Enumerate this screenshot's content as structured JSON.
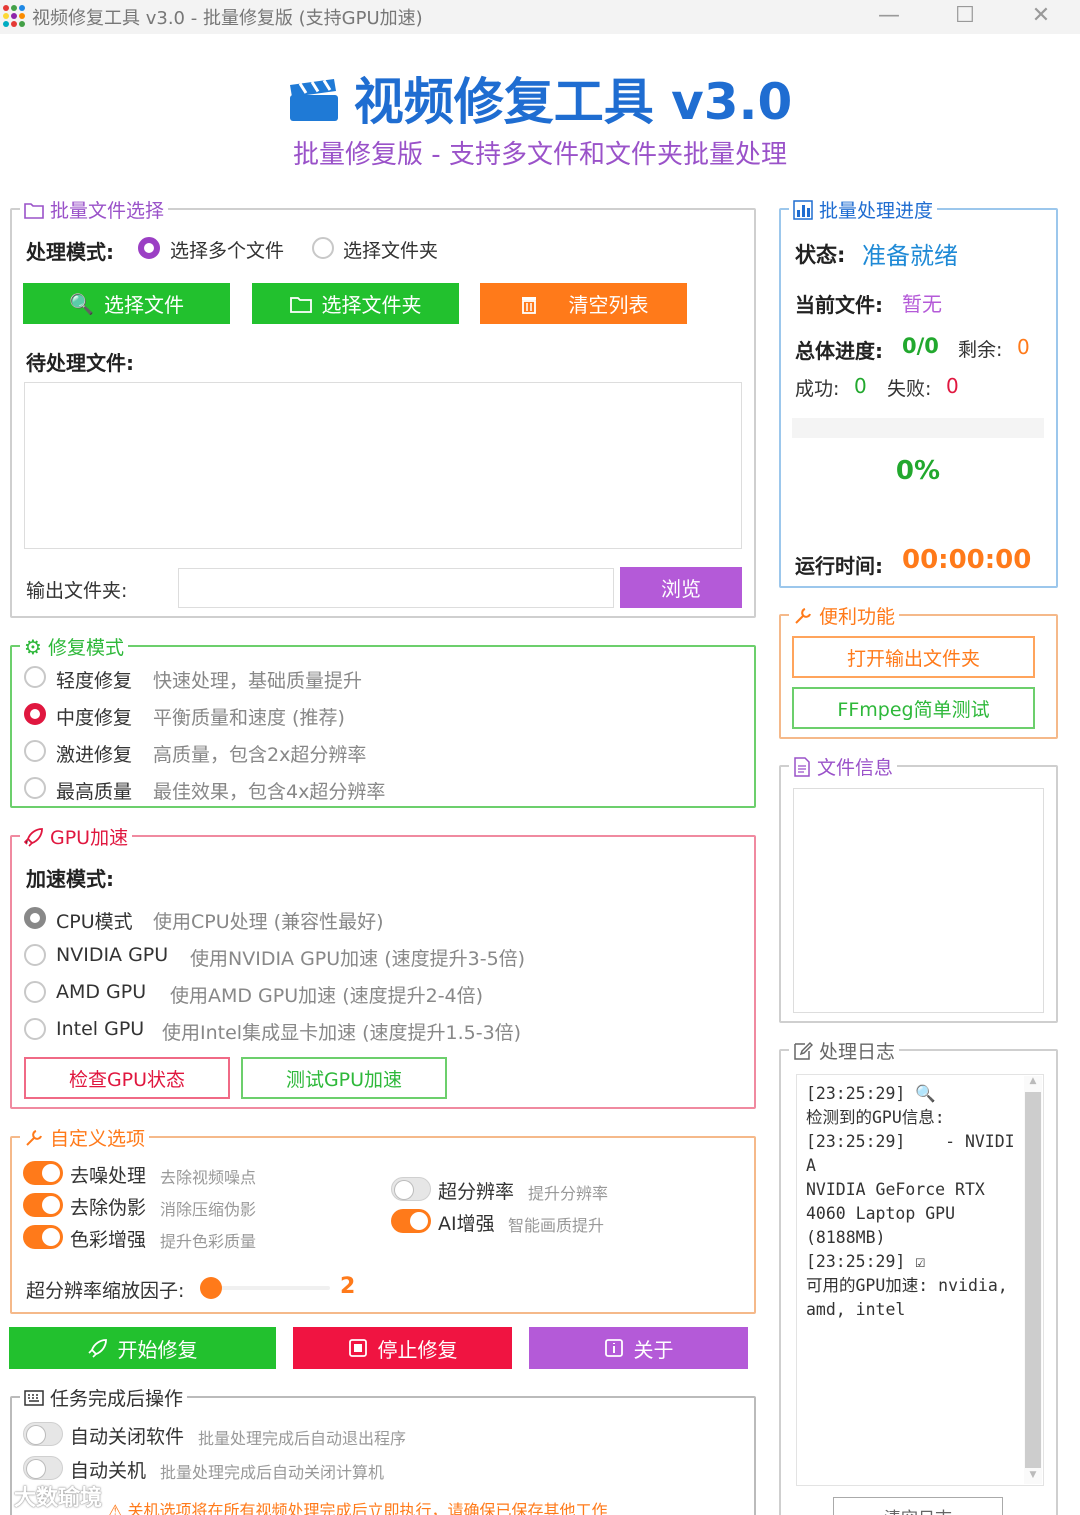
{
  "window": {
    "title": "视频修复工具 v3.0 - 批量修复版 (支持GPU加速)",
    "minimize": "—",
    "maximize": "☐",
    "close": "✕"
  },
  "header": {
    "title": "视频修复工具 v3.0",
    "subtitle": "批量修复版 - 支持多文件和文件夹批量处理"
  },
  "file_select": {
    "legend": "批量文件选择",
    "mode_label": "处理模式:",
    "mode_options": [
      "选择多个文件",
      "选择文件夹"
    ],
    "selected_mode": "选择多个文件",
    "buttons": {
      "select_files": "选择文件",
      "select_folder": "选择文件夹",
      "clear_list": "清空列表"
    },
    "pending_label": "待处理文件:",
    "output_label": "输出文件夹:",
    "output_value": "",
    "browse": "浏览"
  },
  "repair_mode": {
    "legend": "修复模式",
    "options": [
      {
        "name": "轻度修复",
        "desc": "快速处理，基础质量提升"
      },
      {
        "name": "中度修复",
        "desc": "平衡质量和速度 (推荐)"
      },
      {
        "name": "激进修复",
        "desc": "高质量，包含2x超分辨率"
      },
      {
        "name": "最高质量",
        "desc": "最佳效果，包含4x超分辨率"
      }
    ],
    "selected": "中度修复"
  },
  "gpu": {
    "legend": "GPU加速",
    "mode_label": "加速模式:",
    "options": [
      {
        "name": "CPU模式",
        "desc": "使用CPU处理 (兼容性最好)"
      },
      {
        "name": "NVIDIA GPU",
        "desc": "使用NVIDIA GPU加速 (速度提升3-5倍)"
      },
      {
        "name": "AMD GPU",
        "desc": "使用AMD GPU加速 (速度提升2-4倍)"
      },
      {
        "name": "Intel GPU",
        "desc": "使用Intel集成显卡加速 (速度提升1.5-3倍)"
      }
    ],
    "selected": "CPU模式",
    "check_button": "检查GPU状态",
    "test_button": "测试GPU加速"
  },
  "custom": {
    "legend": "自定义选项",
    "options": [
      {
        "name": "去噪处理",
        "desc": "去除视频噪点",
        "on": true
      },
      {
        "name": "去除伪影",
        "desc": "消除压缩伪影",
        "on": true
      },
      {
        "name": "色彩增强",
        "desc": "提升色彩质量",
        "on": true
      },
      {
        "name": "超分辨率",
        "desc": "提升分辨率",
        "on": false
      },
      {
        "name": "AI增强",
        "desc": "智能画质提升",
        "on": true
      }
    ],
    "scale_label": "超分辨率缩放因子:",
    "scale_value": "2",
    "scale_level": 0.0
  },
  "actions": {
    "start": "开始修复",
    "stop": "停止修复",
    "about": "关于"
  },
  "after_task": {
    "legend": "任务完成后操作",
    "options": [
      {
        "name": "自动关闭软件",
        "desc": "批量处理完成后自动退出程序",
        "on": false
      },
      {
        "name": "自动关机",
        "desc": "批量处理完成后自动关闭计算机",
        "on": false
      }
    ],
    "warning": "关机选项将在所有视频处理完成后立即执行，请确保已保存其他工作"
  },
  "progress": {
    "legend": "批量处理进度",
    "status_label": "状态:",
    "status_value": "准备就绪",
    "current_label": "当前文件:",
    "current_value": "暂无",
    "total_label": "总体进度:",
    "total_value": "0/0",
    "remaining_label": "剩余:",
    "remaining_value": "0",
    "success_label": "成功:",
    "success_value": "0",
    "fail_label": "失败:",
    "fail_value": "0",
    "percent": "0%",
    "runtime_label": "运行时间:",
    "runtime_value": "00:00:00"
  },
  "tools": {
    "legend": "便利功能",
    "open_output": "打开输出文件夹",
    "ffmpeg_test": "FFmpeg简单测试"
  },
  "file_info": {
    "legend": "文件信息"
  },
  "log": {
    "legend": "处理日志",
    "text": "[23:25:29] 🔍\n检测到的GPU信息:\n[23:25:29]    - NVIDIA\nNVIDIA GeForce RTX\n4060 Laptop GPU\n(8188MB)\n[23:25:29] ☑\n可用的GPU加速: nvidia,\namd, intel",
    "clear_button": "清空日志"
  },
  "watermark": "大数瑜境",
  "colors": {
    "green": "#22c12e",
    "orange": "#ff7a1a",
    "red": "#f01441",
    "purple": "#b45ad8",
    "blue": "#1f6dd1"
  }
}
